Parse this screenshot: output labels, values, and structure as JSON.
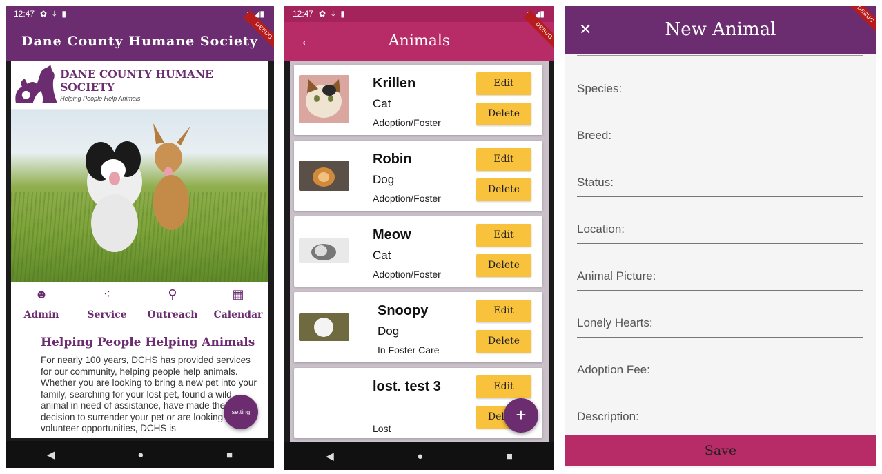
{
  "status": {
    "time": "12:47"
  },
  "debug_label": "DEBUG",
  "home": {
    "app_title": "Dane County Humane Society",
    "logo_title": "DANE COUNTY HUMANE SOCIETY",
    "logo_tagline": "Helping People Help Animals",
    "nav": [
      {
        "label": "Admin",
        "icon": "admin-face-icon"
      },
      {
        "label": "Service",
        "icon": "service-dots-icon"
      },
      {
        "label": "Outreach",
        "icon": "search-icon"
      },
      {
        "label": "Calendar",
        "icon": "calendar-icon"
      }
    ],
    "section_title": "Helping People Helping Animals",
    "section_body": "For nearly 100 years, DCHS has provided services for our community, helping people help animals. Whether you are looking to bring a new pet into your family, searching for your lost pet, found a wild animal in need of assistance, have made the difficult decision to surrender your pet or are looking for volunteer opportunities, DCHS is",
    "fab_label": "setting"
  },
  "animals": {
    "title": "Animals",
    "edit_label": "Edit",
    "delete_label": "Delete",
    "items": [
      {
        "name": "Krillen",
        "species": "Cat",
        "status": "Adoption/Foster"
      },
      {
        "name": "Robin",
        "species": "Dog",
        "status": "Adoption/Foster"
      },
      {
        "name": "Meow",
        "species": "Cat",
        "status": "Adoption/Foster"
      },
      {
        "name": "Snoopy",
        "species": "Dog",
        "status": "In Foster Care"
      },
      {
        "name": "lost. test 3",
        "species": "",
        "status": "Lost"
      }
    ],
    "fab_label": "+"
  },
  "new_animal": {
    "title": "New Animal",
    "fields": [
      "Species:",
      "Breed:",
      "Status:",
      "Location:",
      "Animal Picture:",
      "Lonely Hearts:",
      "Adoption Fee:",
      "Description:"
    ],
    "save_label": "Save"
  },
  "colors": {
    "purple": "#6b2c70",
    "magenta": "#b72b66",
    "button_yellow": "#f9c23c"
  }
}
